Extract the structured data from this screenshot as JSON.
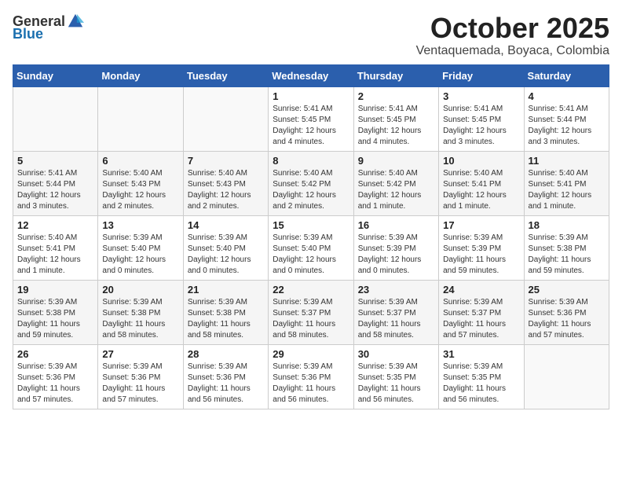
{
  "logo": {
    "general": "General",
    "blue": "Blue"
  },
  "header": {
    "month": "October 2025",
    "location": "Ventaquemada, Boyaca, Colombia"
  },
  "weekdays": [
    "Sunday",
    "Monday",
    "Tuesday",
    "Wednesday",
    "Thursday",
    "Friday",
    "Saturday"
  ],
  "weeks": [
    [
      {
        "day": "",
        "info": ""
      },
      {
        "day": "",
        "info": ""
      },
      {
        "day": "",
        "info": ""
      },
      {
        "day": "1",
        "info": "Sunrise: 5:41 AM\nSunset: 5:45 PM\nDaylight: 12 hours\nand 4 minutes."
      },
      {
        "day": "2",
        "info": "Sunrise: 5:41 AM\nSunset: 5:45 PM\nDaylight: 12 hours\nand 4 minutes."
      },
      {
        "day": "3",
        "info": "Sunrise: 5:41 AM\nSunset: 5:45 PM\nDaylight: 12 hours\nand 3 minutes."
      },
      {
        "day": "4",
        "info": "Sunrise: 5:41 AM\nSunset: 5:44 PM\nDaylight: 12 hours\nand 3 minutes."
      }
    ],
    [
      {
        "day": "5",
        "info": "Sunrise: 5:41 AM\nSunset: 5:44 PM\nDaylight: 12 hours\nand 3 minutes."
      },
      {
        "day": "6",
        "info": "Sunrise: 5:40 AM\nSunset: 5:43 PM\nDaylight: 12 hours\nand 2 minutes."
      },
      {
        "day": "7",
        "info": "Sunrise: 5:40 AM\nSunset: 5:43 PM\nDaylight: 12 hours\nand 2 minutes."
      },
      {
        "day": "8",
        "info": "Sunrise: 5:40 AM\nSunset: 5:42 PM\nDaylight: 12 hours\nand 2 minutes."
      },
      {
        "day": "9",
        "info": "Sunrise: 5:40 AM\nSunset: 5:42 PM\nDaylight: 12 hours\nand 1 minute."
      },
      {
        "day": "10",
        "info": "Sunrise: 5:40 AM\nSunset: 5:41 PM\nDaylight: 12 hours\nand 1 minute."
      },
      {
        "day": "11",
        "info": "Sunrise: 5:40 AM\nSunset: 5:41 PM\nDaylight: 12 hours\nand 1 minute."
      }
    ],
    [
      {
        "day": "12",
        "info": "Sunrise: 5:40 AM\nSunset: 5:41 PM\nDaylight: 12 hours\nand 1 minute."
      },
      {
        "day": "13",
        "info": "Sunrise: 5:39 AM\nSunset: 5:40 PM\nDaylight: 12 hours\nand 0 minutes."
      },
      {
        "day": "14",
        "info": "Sunrise: 5:39 AM\nSunset: 5:40 PM\nDaylight: 12 hours\nand 0 minutes."
      },
      {
        "day": "15",
        "info": "Sunrise: 5:39 AM\nSunset: 5:40 PM\nDaylight: 12 hours\nand 0 minutes."
      },
      {
        "day": "16",
        "info": "Sunrise: 5:39 AM\nSunset: 5:39 PM\nDaylight: 12 hours\nand 0 minutes."
      },
      {
        "day": "17",
        "info": "Sunrise: 5:39 AM\nSunset: 5:39 PM\nDaylight: 11 hours\nand 59 minutes."
      },
      {
        "day": "18",
        "info": "Sunrise: 5:39 AM\nSunset: 5:38 PM\nDaylight: 11 hours\nand 59 minutes."
      }
    ],
    [
      {
        "day": "19",
        "info": "Sunrise: 5:39 AM\nSunset: 5:38 PM\nDaylight: 11 hours\nand 59 minutes."
      },
      {
        "day": "20",
        "info": "Sunrise: 5:39 AM\nSunset: 5:38 PM\nDaylight: 11 hours\nand 58 minutes."
      },
      {
        "day": "21",
        "info": "Sunrise: 5:39 AM\nSunset: 5:38 PM\nDaylight: 11 hours\nand 58 minutes."
      },
      {
        "day": "22",
        "info": "Sunrise: 5:39 AM\nSunset: 5:37 PM\nDaylight: 11 hours\nand 58 minutes."
      },
      {
        "day": "23",
        "info": "Sunrise: 5:39 AM\nSunset: 5:37 PM\nDaylight: 11 hours\nand 58 minutes."
      },
      {
        "day": "24",
        "info": "Sunrise: 5:39 AM\nSunset: 5:37 PM\nDaylight: 11 hours\nand 57 minutes."
      },
      {
        "day": "25",
        "info": "Sunrise: 5:39 AM\nSunset: 5:36 PM\nDaylight: 11 hours\nand 57 minutes."
      }
    ],
    [
      {
        "day": "26",
        "info": "Sunrise: 5:39 AM\nSunset: 5:36 PM\nDaylight: 11 hours\nand 57 minutes."
      },
      {
        "day": "27",
        "info": "Sunrise: 5:39 AM\nSunset: 5:36 PM\nDaylight: 11 hours\nand 57 minutes."
      },
      {
        "day": "28",
        "info": "Sunrise: 5:39 AM\nSunset: 5:36 PM\nDaylight: 11 hours\nand 56 minutes."
      },
      {
        "day": "29",
        "info": "Sunrise: 5:39 AM\nSunset: 5:36 PM\nDaylight: 11 hours\nand 56 minutes."
      },
      {
        "day": "30",
        "info": "Sunrise: 5:39 AM\nSunset: 5:35 PM\nDaylight: 11 hours\nand 56 minutes."
      },
      {
        "day": "31",
        "info": "Sunrise: 5:39 AM\nSunset: 5:35 PM\nDaylight: 11 hours\nand 56 minutes."
      },
      {
        "day": "",
        "info": ""
      }
    ]
  ]
}
